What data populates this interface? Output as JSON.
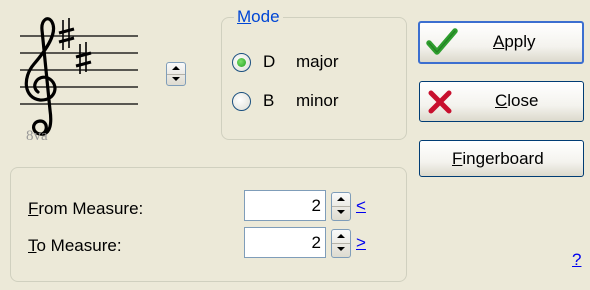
{
  "key_signature": {
    "clef": "treble-clef-icon",
    "sharps": 2,
    "octave_marking": "8va"
  },
  "mode": {
    "legend_underlined": "M",
    "legend_rest": "ode",
    "options": [
      {
        "key": "D",
        "quality": "major",
        "selected": true
      },
      {
        "key": "B",
        "quality": "minor",
        "selected": false
      }
    ]
  },
  "measures": {
    "from": {
      "label_underlined": "F",
      "label_rest": "rom Measure:",
      "value": "2",
      "nav": "<"
    },
    "to": {
      "label_underlined": "T",
      "label_rest": "o Measure:",
      "value": "2",
      "nav": ">"
    }
  },
  "buttons": {
    "apply": {
      "underlined": "A",
      "rest": "pply"
    },
    "close": {
      "underlined": "C",
      "rest": "lose"
    },
    "fingerboard": {
      "underlined": "F",
      "rest": "ingerboard"
    }
  },
  "help": {
    "label": "?"
  },
  "colors": {
    "check_green": "#2e9e2e",
    "close_red": "#c8102e",
    "link_blue": "#0000ee",
    "legend_blue": "#0046d5"
  }
}
